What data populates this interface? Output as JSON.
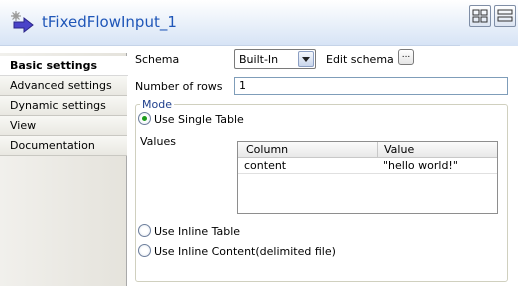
{
  "header": {
    "title": "tFixedFlowInput_1"
  },
  "nav": {
    "items": [
      {
        "label": "Basic settings"
      },
      {
        "label": "Advanced settings"
      },
      {
        "label": "Dynamic settings"
      },
      {
        "label": "View"
      },
      {
        "label": "Documentation"
      }
    ]
  },
  "form": {
    "schema_label": "Schema",
    "schema_value": "Built-In",
    "edit_schema_label": "Edit schema",
    "edit_schema_button": "...",
    "rows_label": "Number of rows",
    "rows_value": "1",
    "mode_label": "Mode",
    "mode_options": [
      {
        "label": "Use Single Table",
        "selected": true
      },
      {
        "label": "Use Inline Table",
        "selected": false
      },
      {
        "label": "Use Inline Content(delimited file)",
        "selected": false
      }
    ],
    "values_label": "Values",
    "table": {
      "columns": [
        "Column",
        "Value"
      ],
      "rows": [
        [
          "content",
          "\"hello world!\""
        ]
      ]
    }
  },
  "colors": {
    "title": "#1f56b8",
    "radio_selected": "#1c9b1c"
  }
}
